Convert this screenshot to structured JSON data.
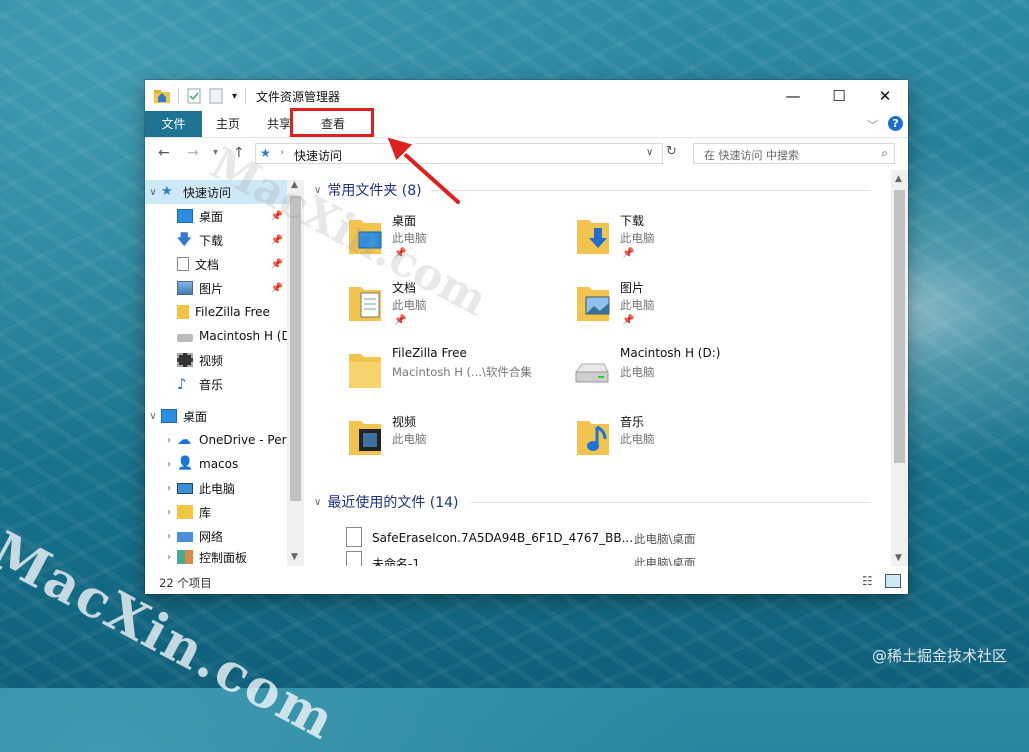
{
  "window": {
    "title": "文件资源管理器",
    "controls": {
      "minimize": "—",
      "maximize": "☐",
      "close": "✕"
    }
  },
  "ribbon": {
    "tabs": [
      "文件",
      "主页",
      "共享",
      "查看"
    ],
    "highlighted_tab": "查看"
  },
  "address": {
    "path": "快速访问",
    "search_placeholder": "在 快速访问 中搜索"
  },
  "nav": {
    "items": [
      {
        "label": "快速访问",
        "icon": "star-icon",
        "pinned": false,
        "expanded": true
      },
      {
        "label": "桌面",
        "icon": "desktop-icon",
        "pinned": true
      },
      {
        "label": "下载",
        "icon": "download-icon",
        "pinned": true
      },
      {
        "label": "文档",
        "icon": "document-icon",
        "pinned": true
      },
      {
        "label": "图片",
        "icon": "pictures-icon",
        "pinned": true
      },
      {
        "label": "FileZilla Free",
        "icon": "folder-icon",
        "pinned": false
      },
      {
        "label": "Macintosh H (D:",
        "icon": "drive-icon",
        "pinned": false
      },
      {
        "label": "视频",
        "icon": "video-icon",
        "pinned": false
      },
      {
        "label": "音乐",
        "icon": "music-icon",
        "pinned": false
      },
      {
        "label": "桌面",
        "icon": "desktop-icon",
        "pinned": false,
        "expanded": true
      },
      {
        "label": "OneDrive - Per",
        "icon": "cloud-icon",
        "pinned": false
      },
      {
        "label": "macos",
        "icon": "user-icon",
        "pinned": false
      },
      {
        "label": "此电脑",
        "icon": "computer-icon",
        "pinned": false
      },
      {
        "label": "库",
        "icon": "library-icon",
        "pinned": false
      },
      {
        "label": "网络",
        "icon": "network-icon",
        "pinned": false
      },
      {
        "label": "控制面板",
        "icon": "control-panel-icon",
        "pinned": false
      }
    ]
  },
  "content": {
    "frequent_header": "常用文件夹 (8)",
    "frequent": [
      {
        "name": "桌面",
        "sub": "此电脑",
        "icon": "desktop-folder-icon",
        "pinned": true
      },
      {
        "name": "下载",
        "sub": "此电脑",
        "icon": "download-folder-icon",
        "pinned": true
      },
      {
        "name": "文档",
        "sub": "此电脑",
        "icon": "documents-folder-icon",
        "pinned": true
      },
      {
        "name": "图片",
        "sub": "此电脑",
        "icon": "pictures-folder-icon",
        "pinned": true
      },
      {
        "name": "FileZilla Free",
        "sub": "Macintosh H (...\\软件合集",
        "icon": "folder-icon",
        "pinned": false
      },
      {
        "name": "Macintosh H (D:)",
        "sub": "此电脑",
        "icon": "drive-icon",
        "pinned": false
      },
      {
        "name": "视频",
        "sub": "此电脑",
        "icon": "video-folder-icon",
        "pinned": false
      },
      {
        "name": "音乐",
        "sub": "此电脑",
        "icon": "music-folder-icon",
        "pinned": false
      }
    ],
    "recent_header": "最近使用的文件 (14)",
    "recent": [
      {
        "name": "SafeEraseIcon.7A5DA94B_6F1D_4767_BB...",
        "location": "此电脑\\桌面"
      },
      {
        "name": "未命名-1",
        "location": "此电脑\\桌面"
      }
    ]
  },
  "status": {
    "item_count": "22 个项目"
  },
  "watermarks": {
    "big": "MacXin.com",
    "small": "MacXin.com",
    "credit": "@稀土掘金技术社区"
  },
  "colors": {
    "file_tab": "#1f7494",
    "highlight": "#e0201e",
    "group_header": "#1e3287"
  }
}
